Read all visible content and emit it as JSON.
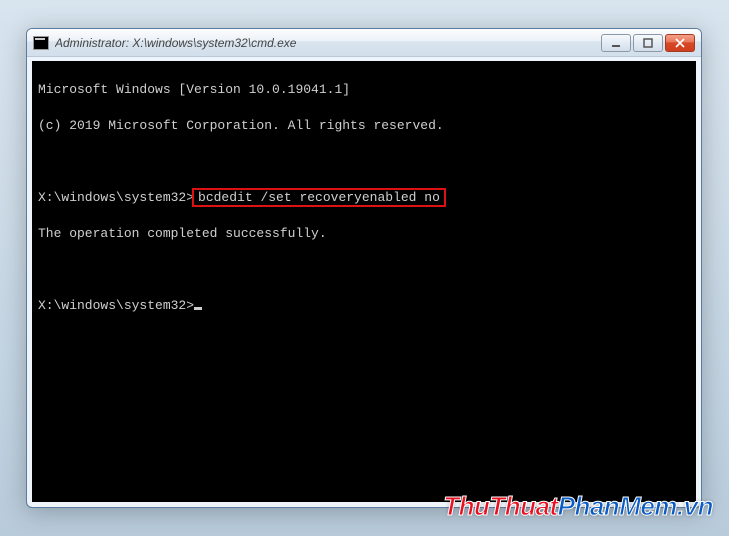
{
  "window": {
    "title": "Administrator: X:\\windows\\system32\\cmd.exe"
  },
  "console": {
    "line1": "Microsoft Windows [Version 10.0.19041.1]",
    "line2": "(c) 2019 Microsoft Corporation. All rights reserved.",
    "prompt1_path": "X:\\windows\\system32>",
    "command1": "bcdedit /set recoveryenabled no",
    "result1": "The operation completed successfully.",
    "prompt2_path": "X:\\windows\\system32>"
  },
  "watermark": {
    "part1": "ThuThuat",
    "part2": "PhanMem.vn"
  }
}
